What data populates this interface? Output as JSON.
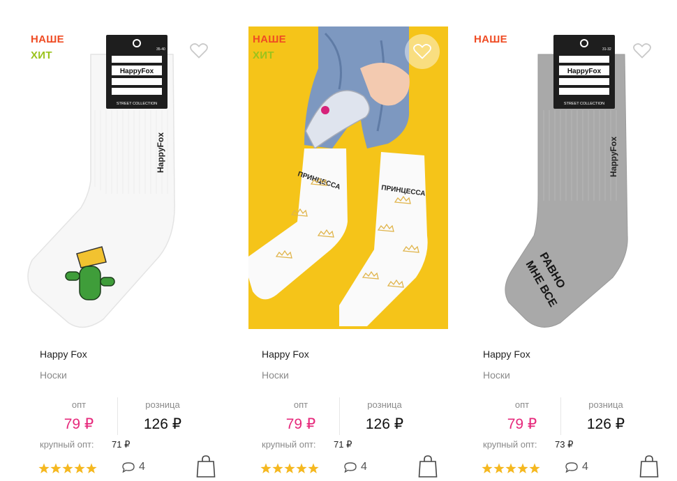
{
  "products": [
    {
      "badges": [
        "НАШЕ",
        "ХИТ"
      ],
      "brand": "Happy Fox",
      "type": "Носки",
      "opt_label": "опт",
      "opt_price": "79 ₽",
      "retail_label": "розница",
      "retail_price": "126 ₽",
      "bulk_label": "крупный опт:",
      "bulk_price": "71 ₽",
      "rating": 5,
      "reviews": "4",
      "image": {
        "sock_color": "#f7f7f7",
        "tag_brand": "HappyFox",
        "tag_line": "STREET COLLECTION",
        "tag_size": "35-40",
        "side_text": "HappyFox"
      }
    },
    {
      "badges": [
        "НАШЕ",
        "ХИТ"
      ],
      "brand": "Happy Fox",
      "type": "Носки",
      "opt_label": "опт",
      "opt_price": "79 ₽",
      "retail_label": "розница",
      "retail_price": "126 ₽",
      "bulk_label": "крупный опт:",
      "bulk_price": "71 ₽",
      "rating": 5,
      "reviews": "4",
      "image": {
        "background": "#f5c419",
        "sock_text": "ПРИНЦЕССА"
      }
    },
    {
      "badges": [
        "НАШЕ"
      ],
      "brand": "Happy Fox",
      "type": "Носки",
      "opt_label": "опт",
      "opt_price": "79 ₽",
      "retail_label": "розница",
      "retail_price": "126 ₽",
      "bulk_label": "крупный опт:",
      "bulk_price": "73 ₽",
      "rating": 5,
      "reviews": "4",
      "image": {
        "sock_color": "#a9a9a9",
        "tag_brand": "HappyFox",
        "tag_line": "STREET COLLECTION",
        "tag_size": "31-32",
        "side_text": "HappyFox",
        "sole_text_1": "МНЕ ВСЕ",
        "sole_text_2": "РАВНО"
      }
    }
  ],
  "colors": {
    "badge_ours": "#ef4b23",
    "badge_hit": "#9ac31c",
    "price_opt": "#e6287b",
    "star": "#f5b820"
  }
}
